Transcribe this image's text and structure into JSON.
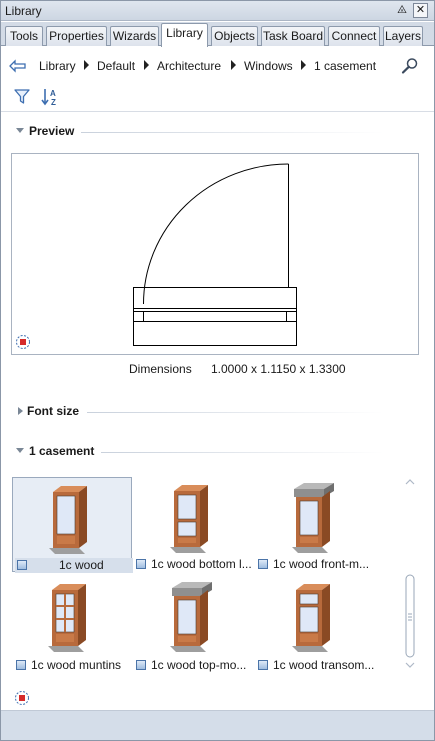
{
  "window": {
    "title": "Library",
    "pin_glyph": "⨻",
    "close_glyph": "✕"
  },
  "tabs": [
    {
      "label": "Tools"
    },
    {
      "label": "Properties"
    },
    {
      "label": "Wizards"
    },
    {
      "label": "Library",
      "active": true
    },
    {
      "label": "Objects"
    },
    {
      "label": "Task Board"
    },
    {
      "label": "Connect"
    },
    {
      "label": "Layers"
    }
  ],
  "breadcrumb": {
    "back_icon": "back-arrow-icon",
    "items": [
      "Library",
      "Default",
      "Architecture",
      "Windows",
      "1 casement"
    ],
    "search_icon": "search-icon"
  },
  "toolbar": {
    "filter_icon": "filter-icon",
    "sort_icon": "sort-az-icon"
  },
  "preview_section": {
    "title": "Preview",
    "expanded": true
  },
  "preview": {
    "dimensions_label": "Dimensions",
    "dimensions_value": "1.0000 x 1.1150 x 1.3300"
  },
  "font_size_section": {
    "title": "Font size",
    "expanded": false
  },
  "items_section": {
    "title": "1 casement",
    "expanded": true
  },
  "items": [
    {
      "label": "1c wood",
      "selected": true,
      "variant": "plain"
    },
    {
      "label": "1c wood bottom l...",
      "selected": false,
      "variant": "bottom"
    },
    {
      "label": "1c wood front-m...",
      "selected": false,
      "variant": "shutter"
    },
    {
      "label": "1c wood muntins",
      "selected": false,
      "variant": "muntins"
    },
    {
      "label": "1c wood top-mo...",
      "selected": false,
      "variant": "shutter"
    },
    {
      "label": "1c wood transom...",
      "selected": false,
      "variant": "transom"
    }
  ],
  "colors": {
    "accent": "#4b74a8",
    "frame_wood": "#b86a3c",
    "glass": "#dfe8f7",
    "status_bar": "#d4dde9"
  }
}
